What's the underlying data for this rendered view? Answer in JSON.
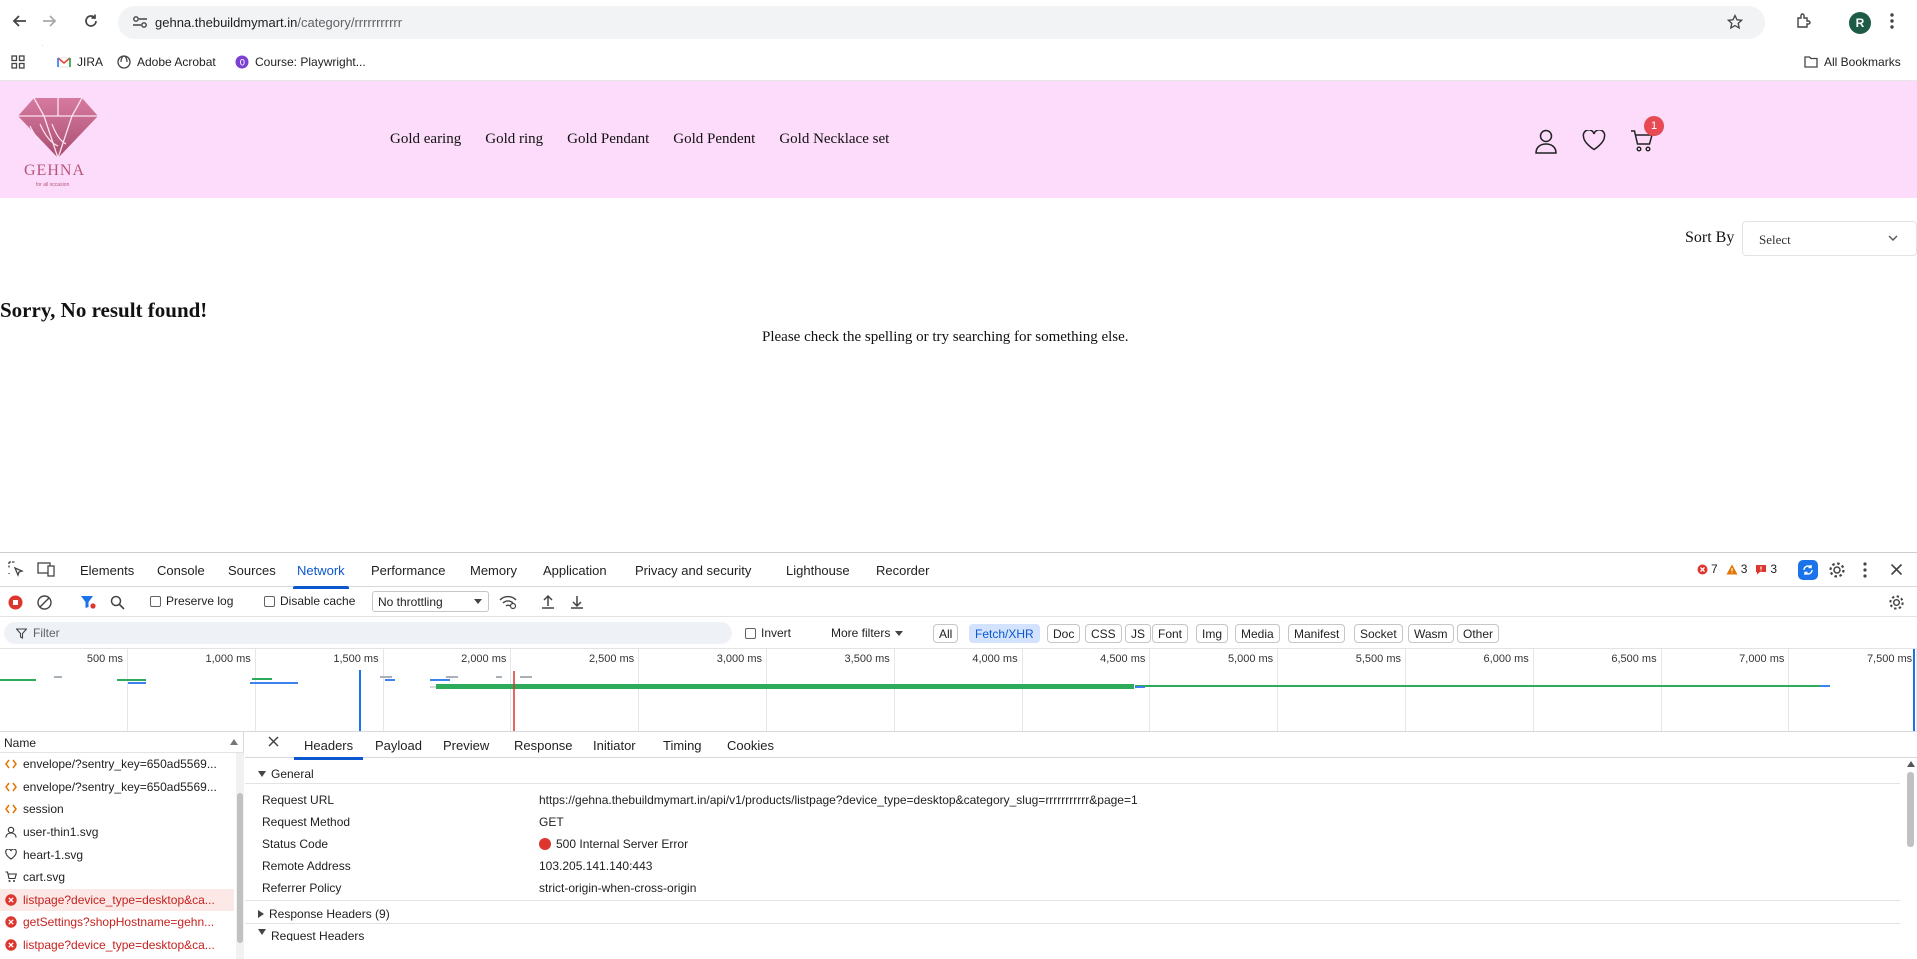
{
  "browser": {
    "url_host": "gehna.thebuildmymart.in",
    "url_path": "/category/rrrrrrrrrrr",
    "profile_initial": "R",
    "bookmarks": [
      {
        "label": "JIRA",
        "icon": "gmail-icon"
      },
      {
        "label": "Adobe Acrobat",
        "icon": "globe-icon"
      },
      {
        "label": "Course: Playwright...",
        "icon": "course-icon"
      }
    ],
    "all_bookmarks": "All Bookmarks"
  },
  "site": {
    "brand": "GEHNA",
    "tagline": "for all occasion",
    "menu": [
      "Gold earing",
      "Gold ring",
      "Gold Pendant",
      "Gold Pendent",
      "Gold Necklace set"
    ],
    "cart_count": "1",
    "sort_label": "Sort By",
    "sort_value": "Select",
    "empty_title": "Sorry, No result found!",
    "empty_message": "Please check the spelling or try searching for something else.",
    "colors": {
      "header_bg": "#fcdcfa",
      "badge": "#e84a54",
      "logo": "#b7567a"
    }
  },
  "devtools": {
    "tabs": [
      "Elements",
      "Console",
      "Sources",
      "Network",
      "Performance",
      "Memory",
      "Application",
      "Privacy and security",
      "Lighthouse",
      "Recorder"
    ],
    "active_tab": "Network",
    "errors": "7",
    "warnings": "3",
    "issues": "3",
    "preserve_log": "Preserve log",
    "disable_cache": "Disable cache",
    "throttling": "No throttling",
    "filter_placeholder": "Filter",
    "invert": "Invert",
    "more_filters": "More filters",
    "type_filters": [
      "All",
      "Fetch/XHR",
      "Doc",
      "CSS",
      "JS",
      "Font",
      "Img",
      "Media",
      "Manifest",
      "Socket",
      "Wasm",
      "Other"
    ],
    "active_type": "Fetch/XHR",
    "timeline_ticks": [
      "500 ms",
      "1,000 ms",
      "1,500 ms",
      "2,000 ms",
      "2,500 ms",
      "3,000 ms",
      "3,500 ms",
      "4,000 ms",
      "4,500 ms",
      "5,000 ms",
      "5,500 ms",
      "6,000 ms",
      "6,500 ms",
      "7,000 ms",
      "7,500 ms"
    ],
    "name_header": "Name",
    "requests": [
      {
        "name": "envelope/?sentry_key=650ad5569...",
        "type": "fetch",
        "error": false
      },
      {
        "name": "envelope/?sentry_key=650ad5569...",
        "type": "fetch",
        "error": false
      },
      {
        "name": "session",
        "type": "fetch",
        "error": false
      },
      {
        "name": "user-thin1.svg",
        "type": "user",
        "error": false
      },
      {
        "name": "heart-1.svg",
        "type": "heart",
        "error": false
      },
      {
        "name": "cart.svg",
        "type": "cart",
        "error": false
      },
      {
        "name": "listpage?device_type=desktop&ca...",
        "type": "error",
        "error": true
      },
      {
        "name": "getSettings?shopHostname=gehn...",
        "type": "error",
        "error": true
      },
      {
        "name": "listpage?device_type=desktop&ca...",
        "type": "error",
        "error": true
      }
    ],
    "detail_tabs": [
      "Headers",
      "Payload",
      "Preview",
      "Response",
      "Initiator",
      "Timing",
      "Cookies"
    ],
    "general_label": "General",
    "general": [
      {
        "key": "Request URL",
        "value": "https://gehna.thebuildmymart.in/api/v1/products/listpage?device_type=desktop&category_slug=rrrrrrrrrrr&page=1"
      },
      {
        "key": "Request Method",
        "value": "GET"
      },
      {
        "key": "Status Code",
        "value": "500 Internal Server Error"
      },
      {
        "key": "Remote Address",
        "value": "103.205.141.140:443"
      },
      {
        "key": "Referrer Policy",
        "value": "strict-origin-when-cross-origin"
      }
    ],
    "response_headers": "Response Headers (9)",
    "request_headers": "Request Headers"
  }
}
